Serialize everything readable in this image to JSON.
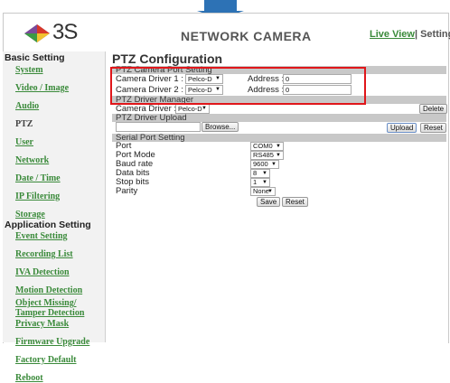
{
  "header": {
    "logo_text": "3S",
    "title": "NETWORK CAMERA",
    "live_view": "Live View",
    "separator": "|",
    "setting": "Setting"
  },
  "sidebar": {
    "basic_heading": "Basic Setting",
    "basic_items": [
      "System",
      "Video / Image",
      "Audio",
      "PTZ",
      "User",
      "Network",
      "Date / Time",
      "IP Filtering",
      "Storage"
    ],
    "app_heading": "Application Setting",
    "app_items": [
      "Event Setting",
      "Recording List",
      "IVA Detection",
      "Motion Detection",
      "Object Missing/",
      "Tamper Detection",
      "Privacy Mask",
      "Firmware Upgrade",
      "Factory Default",
      "Reboot"
    ]
  },
  "main": {
    "title": "PTZ Configuration",
    "port_setting_heading": "PTZ Camera Port Setting",
    "driver1_label": "Camera Driver 1 :",
    "driver1_value": "Pelco-D",
    "address1_label": "Address :",
    "address1_value": "0",
    "driver2_label": "Camera Driver 2 :",
    "driver2_value": "Pelco-D",
    "address2_label": "Address :",
    "address2_value": "0",
    "manager_heading": "PTZ Driver Manager",
    "manager_driver_label": "Camera Driver :",
    "manager_driver_value": "Pelco-D",
    "delete_label": "Delete",
    "upload_heading": "PTZ Driver Upload",
    "browse_label": "Browse...",
    "upload_label": "Upload",
    "reset_label": "Reset",
    "serial_heading": "Serial Port Setting",
    "port_label": "Port",
    "port_value": "COM0",
    "port_mode_label": "Port Mode",
    "port_mode_value": "RS485",
    "baud_label": "Baud rate",
    "baud_value": "9600",
    "data_bits_label": "Data bits",
    "data_bits_value": "8",
    "stop_bits_label": "Stop bits",
    "stop_bits_value": "1",
    "parity_label": "Parity",
    "parity_value": "None",
    "save_label": "Save",
    "serial_reset_label": "Reset"
  },
  "colors": {
    "accent_link": "#3a8a3a",
    "highlight_box": "#e0161a",
    "arrow": "#2d72b5",
    "section_bar": "#c8c8c8"
  }
}
